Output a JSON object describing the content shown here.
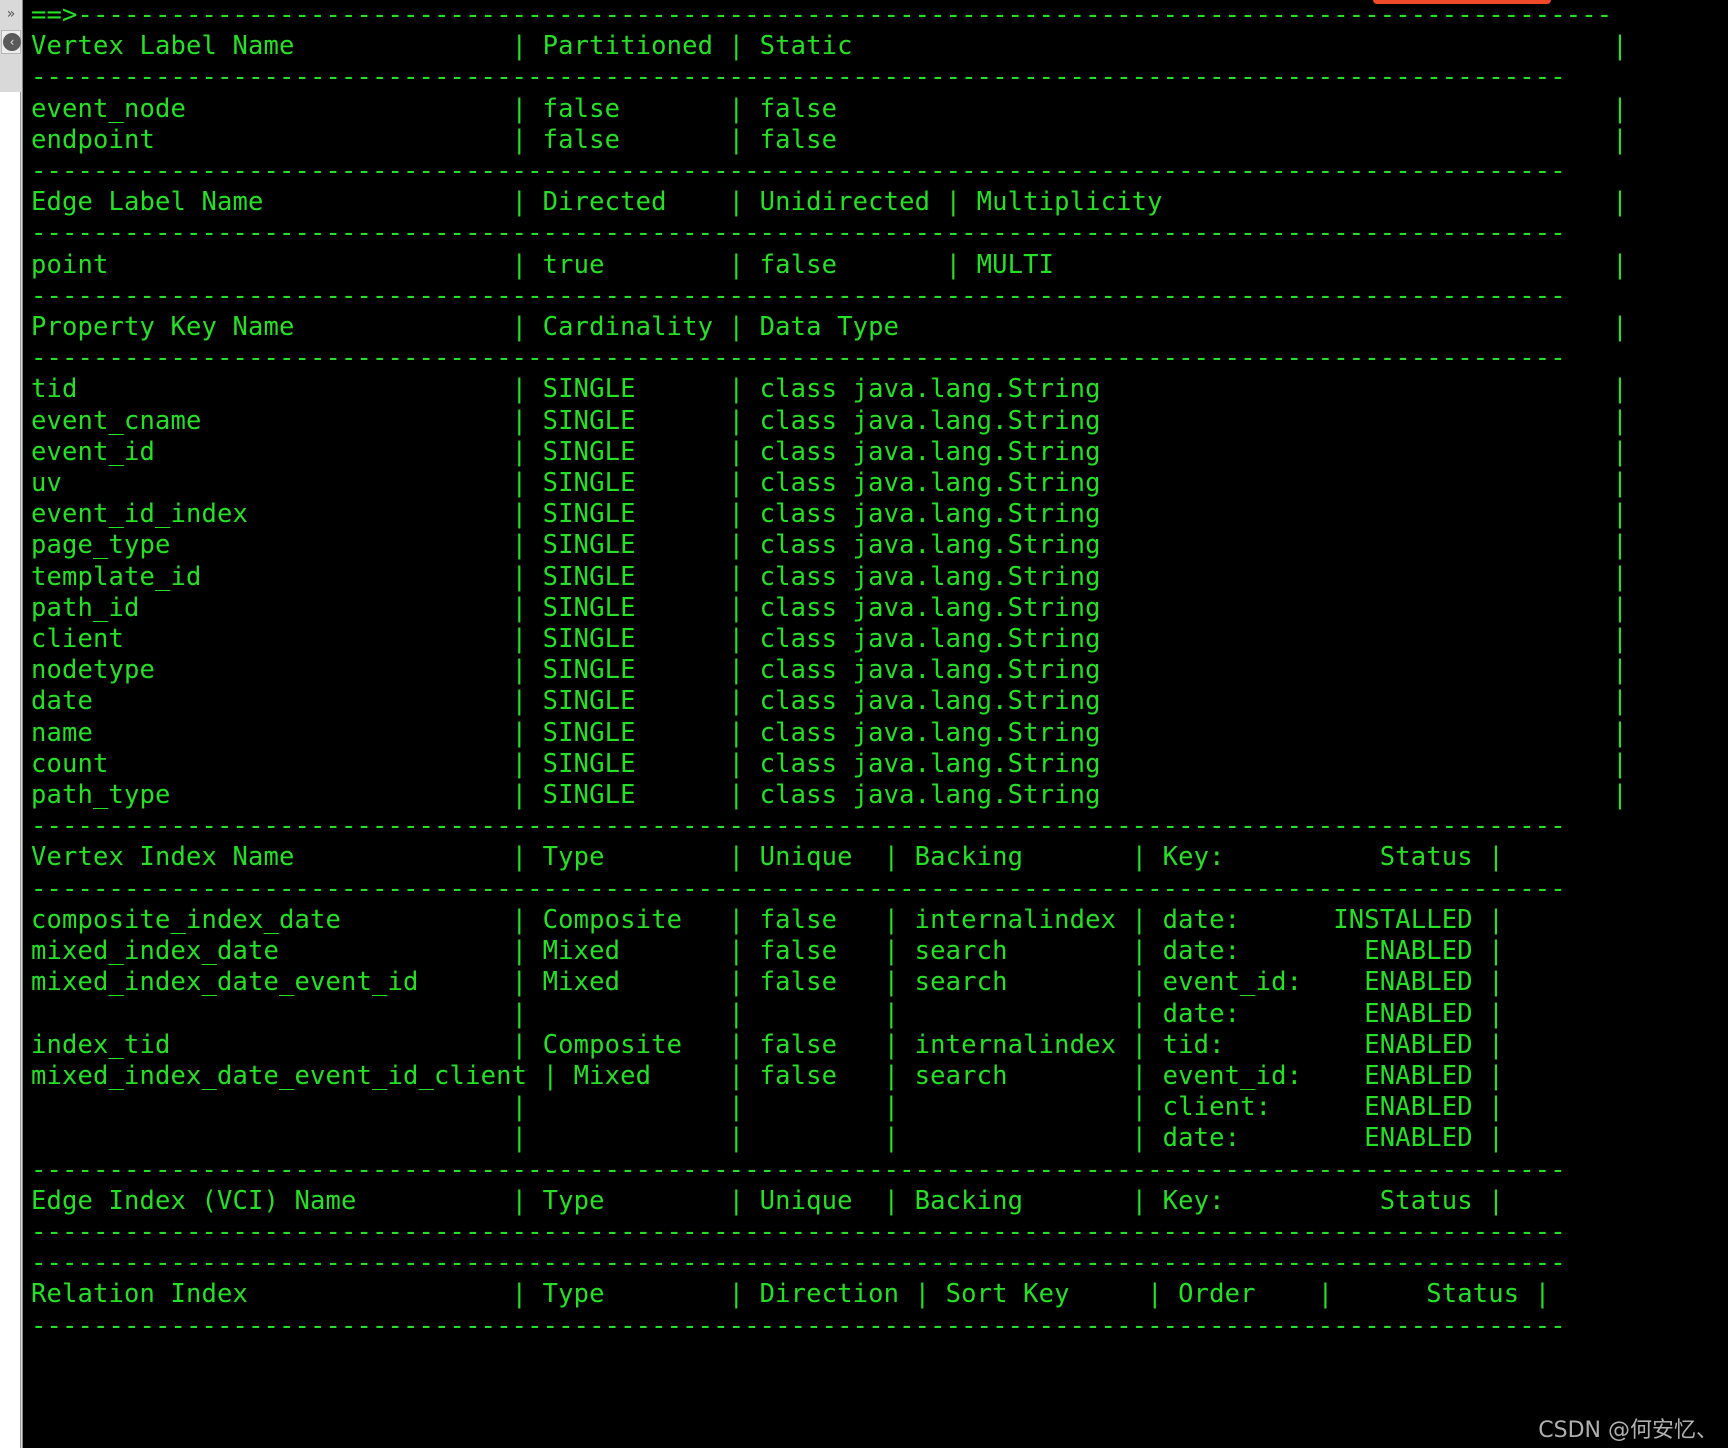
{
  "window": {
    "background": "#000000",
    "foreground": "#25e025",
    "highlight_color": "#f04a2a"
  },
  "sidebar": {
    "expand_icon": "»",
    "collapse_icon": "‹",
    "expand_icon_name": "chevron-double-right-icon",
    "collapse_icon_name": "chevron-left-circle-icon"
  },
  "watermark": {
    "text": "CSDN @何安忆、"
  },
  "terminal": {
    "prompt": "==>",
    "sections": [
      {
        "name": "vertex-labels",
        "header": [
          "Vertex Label Name",
          "Partitioned",
          "Static"
        ],
        "rows": [
          [
            "event_node",
            "false",
            "false"
          ],
          [
            "endpoint",
            "false",
            "false"
          ]
        ]
      },
      {
        "name": "edge-labels",
        "header": [
          "Edge Label Name",
          "Directed",
          "Unidirected",
          "Multiplicity"
        ],
        "rows": [
          [
            "point",
            "true",
            "false",
            "MULTI"
          ]
        ]
      },
      {
        "name": "property-keys",
        "header": [
          "Property Key Name",
          "Cardinality",
          "Data Type"
        ],
        "rows": [
          [
            "tid",
            "SINGLE",
            "class java.lang.String"
          ],
          [
            "event_cname",
            "SINGLE",
            "class java.lang.String"
          ],
          [
            "event_id",
            "SINGLE",
            "class java.lang.String"
          ],
          [
            "uv",
            "SINGLE",
            "class java.lang.String"
          ],
          [
            "event_id_index",
            "SINGLE",
            "class java.lang.String"
          ],
          [
            "page_type",
            "SINGLE",
            "class java.lang.String"
          ],
          [
            "template_id",
            "SINGLE",
            "class java.lang.String"
          ],
          [
            "path_id",
            "SINGLE",
            "class java.lang.String"
          ],
          [
            "client",
            "SINGLE",
            "class java.lang.String"
          ],
          [
            "nodetype",
            "SINGLE",
            "class java.lang.String"
          ],
          [
            "date",
            "SINGLE",
            "class java.lang.String"
          ],
          [
            "name",
            "SINGLE",
            "class java.lang.String"
          ],
          [
            "count",
            "SINGLE",
            "class java.lang.String"
          ],
          [
            "path_type",
            "SINGLE",
            "class java.lang.String"
          ]
        ]
      },
      {
        "name": "vertex-indexes",
        "header": [
          "Vertex Index Name",
          "Type",
          "Unique",
          "Backing",
          "Key:",
          "Status"
        ],
        "rows": [
          [
            "composite_index_date",
            "Composite",
            "false",
            "internalindex",
            "date:",
            "INSTALLED"
          ],
          [
            "mixed_index_date",
            "Mixed",
            "false",
            "search",
            "date:",
            "ENABLED"
          ],
          [
            "mixed_index_date_event_id",
            "Mixed",
            "false",
            "search",
            "event_id:",
            "ENABLED"
          ],
          [
            "",
            "",
            "",
            "",
            "date:",
            "ENABLED"
          ],
          [
            "index_tid",
            "Composite",
            "false",
            "internalindex",
            "tid:",
            "ENABLED"
          ],
          [
            "mixed_index_date_event_id_client",
            "Mixed",
            "false",
            "search",
            "event_id:",
            "ENABLED"
          ],
          [
            "",
            "",
            "",
            "",
            "client:",
            "ENABLED"
          ],
          [
            "",
            "",
            "",
            "",
            "date:",
            "ENABLED"
          ]
        ]
      },
      {
        "name": "edge-indexes",
        "header": [
          "Edge Index (VCI) Name",
          "Type",
          "Unique",
          "Backing",
          "Key:",
          "Status"
        ],
        "rows": []
      },
      {
        "name": "relation-indexes",
        "header": [
          "Relation Index",
          "Type",
          "Direction",
          "Sort Key",
          "Order",
          "Status"
        ],
        "rows": []
      }
    ],
    "lines": [
      "==>---------------------------------------------------------------------------------------------------",
      "Vertex Label Name              | Partitioned | Static                                                 |",
      "---------------------------------------------------------------------------------------------------",
      "event_node                     | false       | false                                                  |",
      "endpoint                       | false       | false                                                  |",
      "---------------------------------------------------------------------------------------------------",
      "Edge Label Name                | Directed    | Unidirected | Multiplicity                             |",
      "---------------------------------------------------------------------------------------------------",
      "point                          | true        | false       | MULTI                                    |",
      "---------------------------------------------------------------------------------------------------",
      "Property Key Name              | Cardinality | Data Type                                              |",
      "---------------------------------------------------------------------------------------------------",
      "tid                            | SINGLE      | class java.lang.String                                 |",
      "event_cname                    | SINGLE      | class java.lang.String                                 |",
      "event_id                       | SINGLE      | class java.lang.String                                 |",
      "uv                             | SINGLE      | class java.lang.String                                 |",
      "event_id_index                 | SINGLE      | class java.lang.String                                 |",
      "page_type                      | SINGLE      | class java.lang.String                                 |",
      "template_id                    | SINGLE      | class java.lang.String                                 |",
      "path_id                        | SINGLE      | class java.lang.String                                 |",
      "client                         | SINGLE      | class java.lang.String                                 |",
      "nodetype                       | SINGLE      | class java.lang.String                                 |",
      "date                           | SINGLE      | class java.lang.String                                 |",
      "name                           | SINGLE      | class java.lang.String                                 |",
      "count                          | SINGLE      | class java.lang.String                                 |",
      "path_type                      | SINGLE      | class java.lang.String                                 |",
      "---------------------------------------------------------------------------------------------------",
      "Vertex Index Name              | Type        | Unique  | Backing       | Key:          Status |",
      "---------------------------------------------------------------------------------------------------",
      "composite_index_date           | Composite   | false   | internalindex | date:      INSTALLED |",
      "mixed_index_date               | Mixed       | false   | search        | date:        ENABLED |",
      "mixed_index_date_event_id      | Mixed       | false   | search        | event_id:    ENABLED |",
      "                               |             |         |               | date:        ENABLED |",
      "index_tid                      | Composite   | false   | internalindex | tid:         ENABLED |",
      "mixed_index_date_event_id_client | Mixed     | false   | search        | event_id:    ENABLED |",
      "                               |             |         |               | client:      ENABLED |",
      "                               |             |         |               | date:        ENABLED |",
      "---------------------------------------------------------------------------------------------------",
      "Edge Index (VCI) Name          | Type        | Unique  | Backing       | Key:          Status |",
      "---------------------------------------------------------------------------------------------------",
      "---------------------------------------------------------------------------------------------------",
      "Relation Index                 | Type        | Direction | Sort Key     | Order    |      Status |",
      "---------------------------------------------------------------------------------------------------"
    ]
  }
}
